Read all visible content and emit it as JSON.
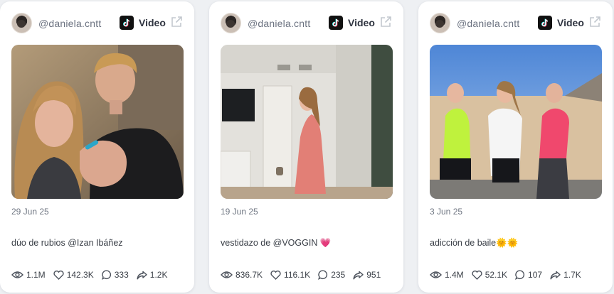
{
  "cards": [
    {
      "handle": "@daniela.cntt",
      "type": "Video",
      "date": "29 Jun 25",
      "caption": "dúo de rubios @Izan Ibáñez",
      "stats": {
        "views": "1.1M",
        "likes": "142.3K",
        "comments": "333",
        "shares": "1.2K"
      }
    },
    {
      "handle": "@daniela.cntt",
      "type": "Video",
      "date": "19 Jun 25",
      "caption": "vestidazo de @VOGGIN 💗",
      "stats": {
        "views": "836.7K",
        "likes": "116.1K",
        "comments": "235",
        "shares": "951"
      }
    },
    {
      "handle": "@daniela.cntt",
      "type": "Video",
      "date": "3 Jun 25",
      "caption": "adicción de baile🌞🌞",
      "stats": {
        "views": "1.4M",
        "likes": "52.1K",
        "comments": "107",
        "shares": "1.7K"
      }
    }
  ],
  "icons": {
    "platform": "tiktok-icon",
    "external": "external-link-icon",
    "views": "eye-icon",
    "likes": "heart-icon",
    "comments": "comment-icon",
    "shares": "share-icon"
  },
  "colors": {
    "card_bg": "#ffffff",
    "page_bg": "#eef0f3",
    "muted": "#6f7682",
    "tiktok": "#111111"
  }
}
